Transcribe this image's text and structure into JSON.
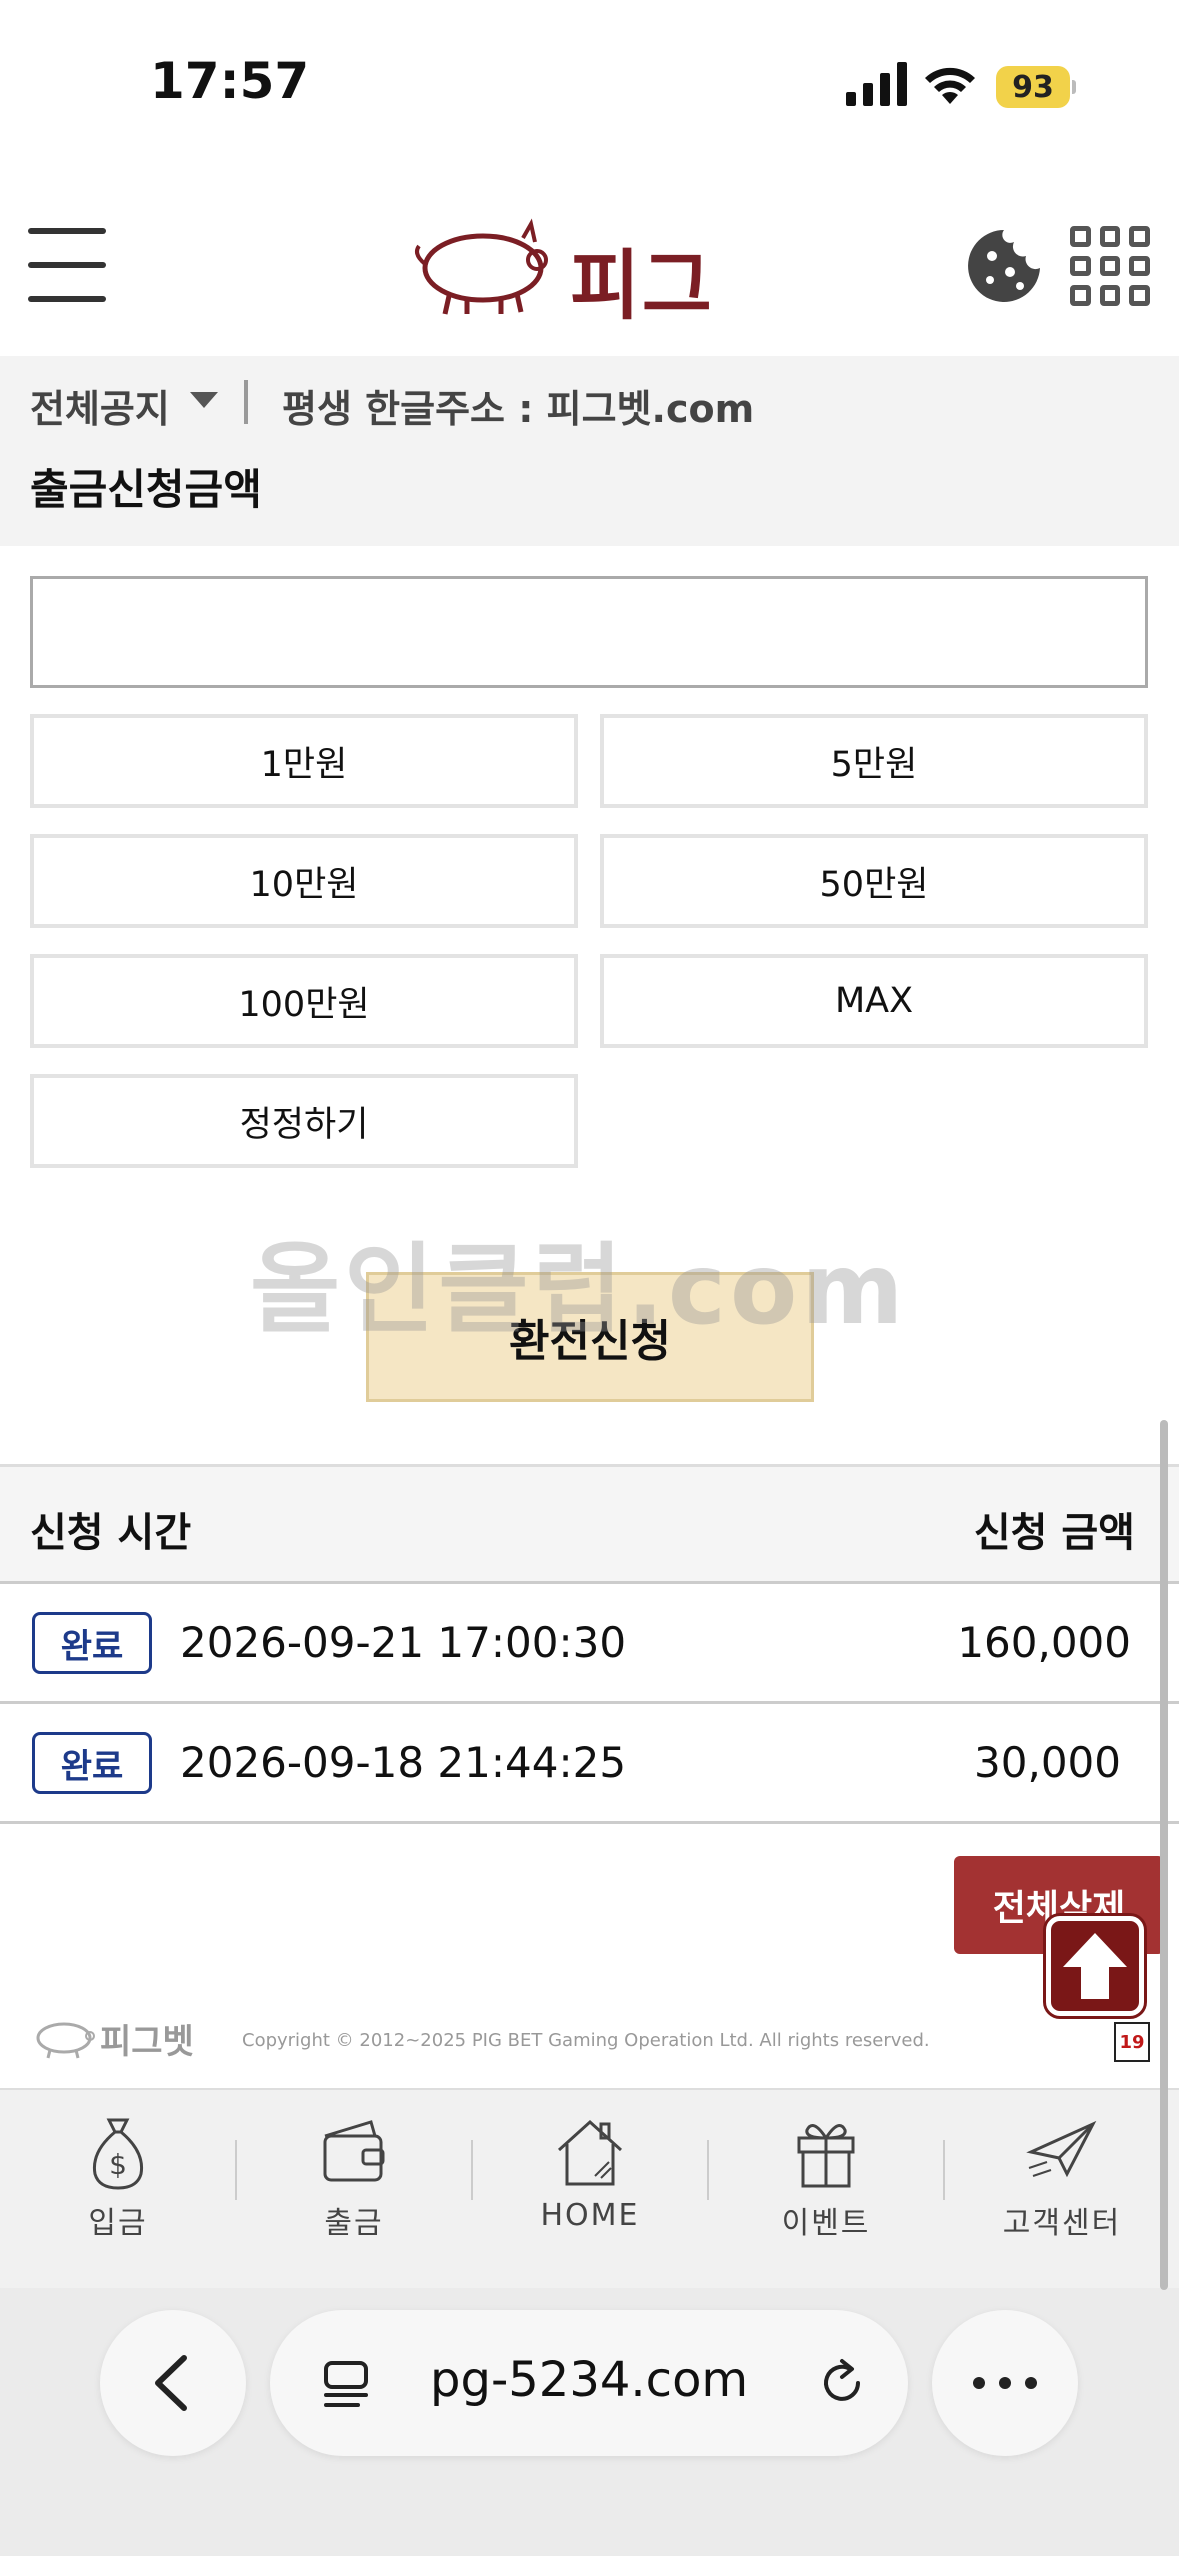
{
  "status_bar": {
    "time": "17:57",
    "battery": "93"
  },
  "header": {
    "logo_text": "피그벳"
  },
  "notice": {
    "category": "전체공지",
    "text": "평생 한글주소 : 피그벳.com"
  },
  "withdraw": {
    "title": "출금신청금액",
    "input_value": "",
    "amount_buttons": [
      "1만원",
      "5만원",
      "10만원",
      "50만원",
      "100만원",
      "MAX"
    ],
    "reset_label": "정정하기",
    "submit_label": "환전신청"
  },
  "watermark": "올인클럽.com",
  "table": {
    "col_time": "신청 시간",
    "col_amount": "신청 금액",
    "rows": [
      {
        "status": "완료",
        "datetime": "2026-09-21 17:00:30",
        "amount": "160,000"
      },
      {
        "status": "완료",
        "datetime": "2026-09-18 21:44:25",
        "amount": "30,000"
      }
    ],
    "delete_all_label": "전체삭제"
  },
  "footer": {
    "logo_text": "피그벳",
    "copyright": "Copyright © 2012~2025 PIG BET Gaming Operation Ltd. All rights reserved.",
    "age_badge": "19"
  },
  "bottom_nav": [
    {
      "label": "입금",
      "icon": "money-bag-icon"
    },
    {
      "label": "출금",
      "icon": "wallet-icon"
    },
    {
      "label": "HOME",
      "icon": "home-icon"
    },
    {
      "label": "이벤트",
      "icon": "gift-icon"
    },
    {
      "label": "고객센터",
      "icon": "paper-plane-icon"
    }
  ],
  "browser": {
    "url": "pg-5234.com"
  },
  "colors": {
    "brand": "#7b1e24",
    "badge": "#1d3a8a",
    "submit_bg": "#f5e6c4",
    "delete_bg": "#a33232"
  }
}
